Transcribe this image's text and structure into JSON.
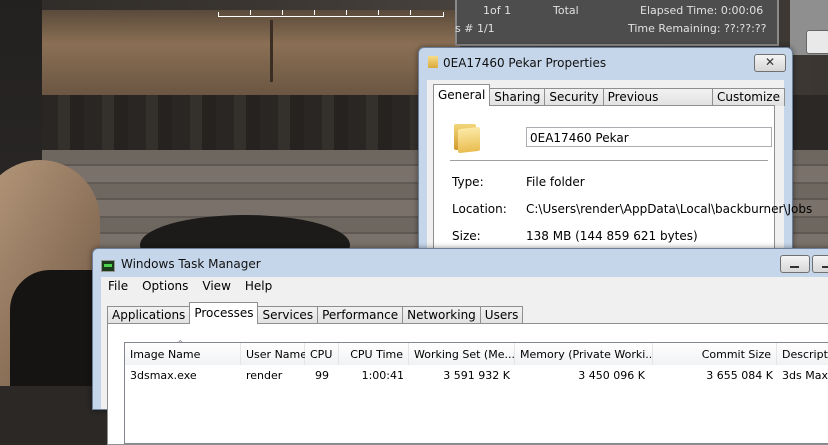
{
  "backburner": {
    "frames": "1of 1",
    "total_label": "Total",
    "elapsed": "Elapsed Time:  0:00:06",
    "tasks": "s # 1/1",
    "remaining": "Time Remaining: ??:??:??"
  },
  "properties": {
    "title": "0EA17460 Pekar Properties",
    "close_glyph": "✕",
    "tabs": [
      "General",
      "Sharing",
      "Security",
      "Previous Versions",
      "Customize"
    ],
    "name_value": "0EA17460 Pekar",
    "type_label": "Type:",
    "type_value": "File folder",
    "location_label": "Location:",
    "location_value": "C:\\Users\\render\\AppData\\Local\\backburner\\Jobs",
    "size_label": "Size:",
    "size_value": "138 MB (144 859 621 bytes)"
  },
  "taskmanager": {
    "title": "Windows Task Manager",
    "menu": [
      "File",
      "Options",
      "View",
      "Help"
    ],
    "tabs": [
      "Applications",
      "Processes",
      "Services",
      "Performance",
      "Networking",
      "Users"
    ],
    "columns": {
      "image": "Image Name",
      "user": "User Name",
      "cpu": "CPU",
      "cputime": "CPU Time",
      "ws": "Working Set (Me...",
      "mem": "Memory (Private Worki...",
      "commit": "Commit Size",
      "desc": "Descriptio"
    },
    "rows": [
      {
        "image": "3dsmax.exe",
        "user": "render",
        "cpu": "99",
        "cputime": "1:00:41",
        "ws": "3 591 932 K",
        "mem": "3 450 096 K",
        "commit": "3 655 084 K",
        "desc": "3ds Max"
      }
    ]
  }
}
